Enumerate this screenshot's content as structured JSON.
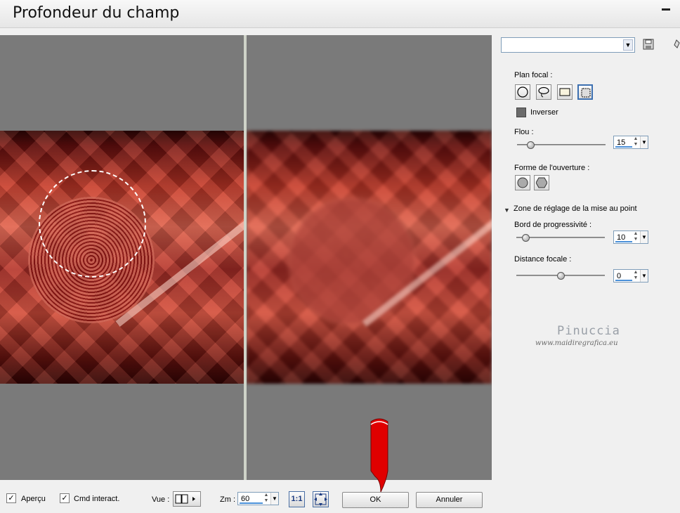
{
  "window": {
    "title": "Profondeur du champ"
  },
  "presets": {
    "selected": ""
  },
  "focal_plane": {
    "label": "Plan focal :",
    "invert_label": "Inverser"
  },
  "blur": {
    "label": "Flou :",
    "value": "15",
    "level": 0.15
  },
  "aperture": {
    "label": "Forme de l'ouverture :"
  },
  "focus_zone": {
    "label": "Zone de réglage de la mise au point",
    "feather_label": "Bord de progressivité :",
    "feather_value": "10",
    "feather_level": 0.1,
    "distance_label": "Distance focale :",
    "distance_value": "0",
    "distance_level": 0.5
  },
  "watermark": {
    "name": "Pinuccia",
    "url": "www.maidiregrafica.eu",
    "pointer_text": "pinuccia"
  },
  "bottom": {
    "preview_label": "Aperçu",
    "interactive_label": "Cmd interact.",
    "view_label": "Vue :",
    "zoom_label": "Zm :",
    "zoom_value": "60",
    "zoom_1to1_label": "1:1",
    "ok_label": "OK",
    "cancel_label": "Annuler"
  }
}
